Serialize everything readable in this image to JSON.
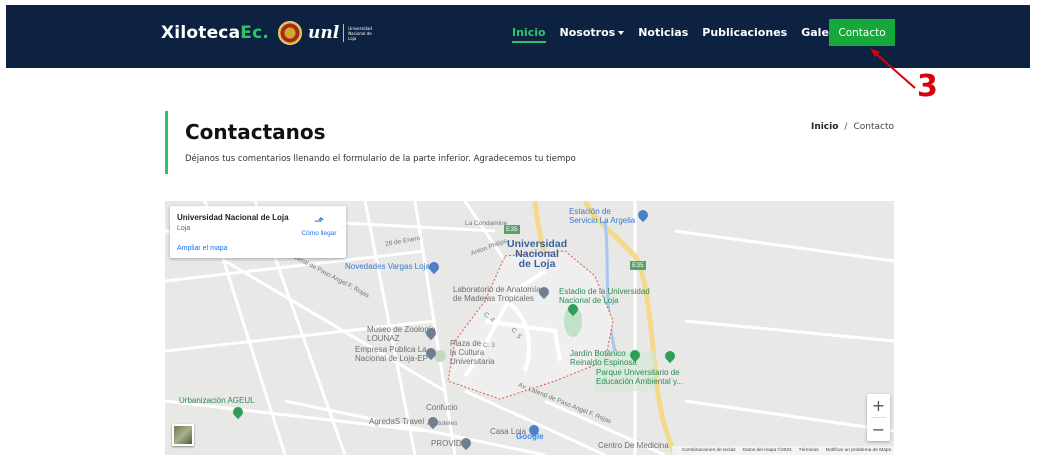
{
  "header": {
    "brand_main": "Xiloteca",
    "brand_accent": "Ec.",
    "unl_logo": "unl",
    "unl_caption": "Universidad Nacional de Loja",
    "nav_items": [
      {
        "label": "Inicio"
      },
      {
        "label": "Nosotros"
      },
      {
        "label": "Noticias"
      },
      {
        "label": "Publicaciones"
      },
      {
        "label": "Galeria"
      }
    ],
    "cta_label": "Contacto"
  },
  "annotation": {
    "number": "3"
  },
  "page": {
    "title": "Contactanos",
    "subtitle": "Déjanos tus comentarios llenando el formulario de la parte inferior. Agradecemos tu tiempo",
    "breadcrumb": {
      "home": "Inicio",
      "separator": "/",
      "current": "Contacto"
    }
  },
  "map": {
    "card": {
      "title": "Universidad Nacional de Loja",
      "subtitle": "Loja",
      "link": "Ampliar el mapa",
      "directions": "Cómo llegar"
    },
    "labels": {
      "university": "Universidad\nNacional\nde Loja",
      "lab": "Laboratorio de Anatomía\nde Maderas Tropicales",
      "stadium": "Estadio de la Universidad\nNacional de Loja",
      "zoo": "Museo de Zoología\nLOUNAZ",
      "empresa": "Empresa Pública La\nNacional de Loja-EP",
      "plaza": "Plaza de\nla Cultura\nUniversitaria",
      "botanic": "Jardín Botánico\nReinaldo Espinosa",
      "park": "Parque Universitario de\nEducación Ambiental y...",
      "novedades": "Novedades Vargas Loja",
      "station": "Estación de\nServicio La Argelia",
      "urbanizacion": "Urbanización AGEUL",
      "agredas": "AgredaS Travel",
      "casa": "Casa Loja",
      "provid": "PROVID",
      "confucio": "Confucio",
      "aristoteles": "Aristoteles",
      "centro": "Centro De Medicina",
      "road_paso": "Lateral de Paso Angel F. Rojas",
      "road_av": "Av. Lateral de Paso Angel F. Rojas",
      "road_condamine": "La Condamine",
      "road_28": "28 de Enero",
      "road_anton": "Anton Philips",
      "road_c3": "C. 3",
      "road_c4": "C. 4",
      "road_c5": "C. 5",
      "shield_1": "E35",
      "shield_2": "E35"
    },
    "google": "Google",
    "attribution": {
      "shortcuts": "Combinaciones de teclas",
      "data": "Datos del mapa ©2024",
      "terms": "Términos",
      "report": "Notificar un problema de Maps"
    },
    "zoom_in": "+",
    "zoom_out": "−"
  },
  "colors": {
    "navbar": "#0d2240",
    "accent_green": "#2cc36b",
    "cta_green": "#16a83a",
    "annotation_red": "#d8000c"
  }
}
